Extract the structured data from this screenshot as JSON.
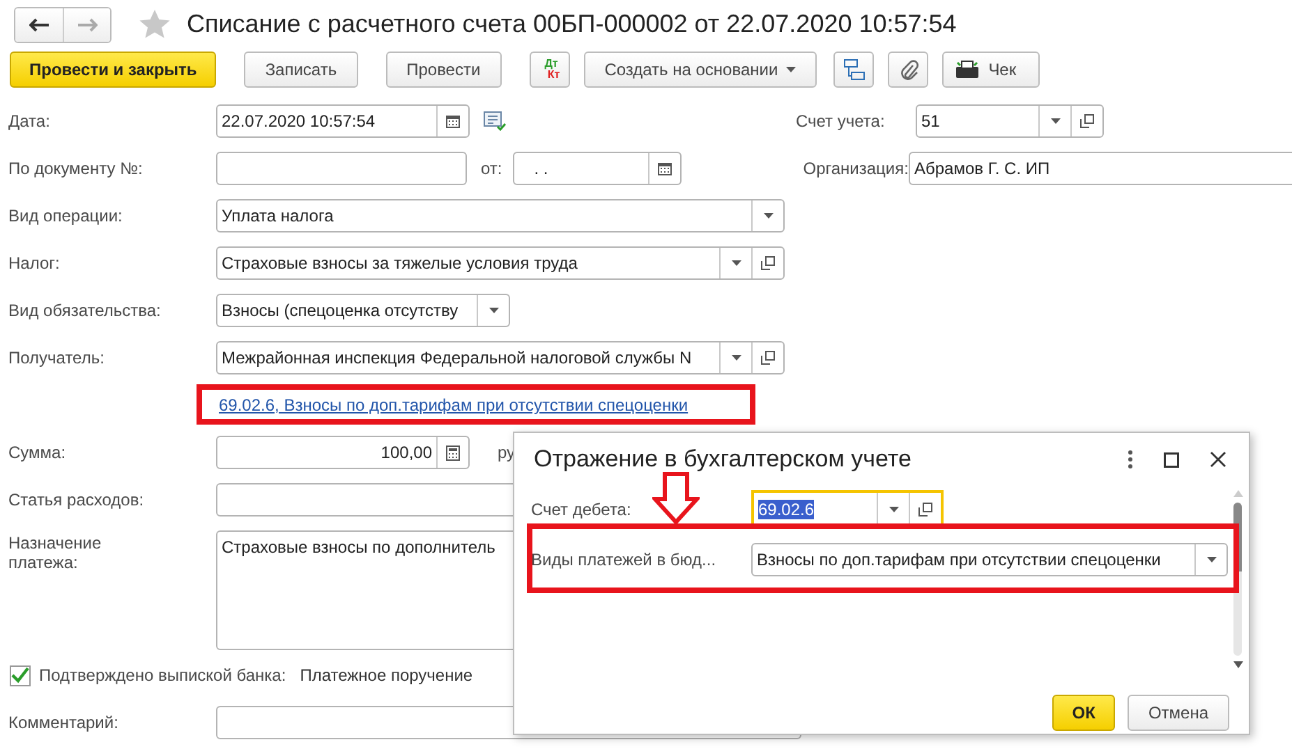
{
  "window": {
    "title": "Списание с расчетного счета 00БП-000002 от 22.07.2020 10:57:54",
    "favorite": false
  },
  "toolbar": [
    {
      "kind": "primary",
      "label": "Провести и закрыть"
    },
    {
      "kind": "text",
      "label": "Записать"
    },
    {
      "kind": "text",
      "label": "Провести"
    },
    {
      "kind": "dtkt",
      "label": "Дт",
      "label2": "Кт"
    },
    {
      "kind": "menu",
      "label": "Создать на основании"
    },
    {
      "kind": "structure"
    },
    {
      "kind": "attach"
    },
    {
      "kind": "receipt",
      "label": "Чек"
    }
  ],
  "form": {
    "date": {
      "label": "Дата:",
      "value": "22.07.2020 10:57:54"
    },
    "account": {
      "label": "Счет учета:",
      "value": "51"
    },
    "doc_number": {
      "label": "По документу №:",
      "from_label": "от:",
      "from_value": ".  ."
    },
    "organization": {
      "label": "Организация:",
      "value": "Абрамов Г. С. ИП"
    },
    "operation": {
      "label": "Вид операции:",
      "value": "Уплата налога"
    },
    "tax": {
      "label": "Налог:",
      "value": "Страховые взносы за тяжелые условия труда"
    },
    "obligation": {
      "label": "Вид обязательства:",
      "value": "Взносы (спецоценка отсутству"
    },
    "recipient": {
      "label": "Получатель:",
      "value": "Межрайонная инспекция Федеральной налоговой службы N"
    },
    "account_link": "69.02.6, Взносы по доп.тарифам при отсутствии спецоценки",
    "amount": {
      "label": "Сумма:",
      "value": "100,00",
      "currency": "ру"
    },
    "expense": {
      "label": "Статья расходов:"
    },
    "purpose": {
      "label": "Назначение платежа:",
      "value": "Страховые взносы по дополнитель"
    },
    "confirmed": {
      "label": "Подтверждено выпиской банка:",
      "checked": true,
      "document": "Платежное поручение"
    },
    "comment": {
      "label": "Комментарий:"
    }
  },
  "dialog": {
    "title": "Отражение в бухгалтерском учете",
    "debit": {
      "label": "Счет дебета:",
      "value": "69.02.6",
      "focused": true
    },
    "payment_type": {
      "label": "Виды платежей в бюд...",
      "value": "Взносы по доп.тарифам при отсутствии спецоценки"
    },
    "buttons": [
      {
        "kind": "primary",
        "label": "ОК"
      },
      {
        "kind": "text",
        "label": "Отмена"
      }
    ]
  }
}
